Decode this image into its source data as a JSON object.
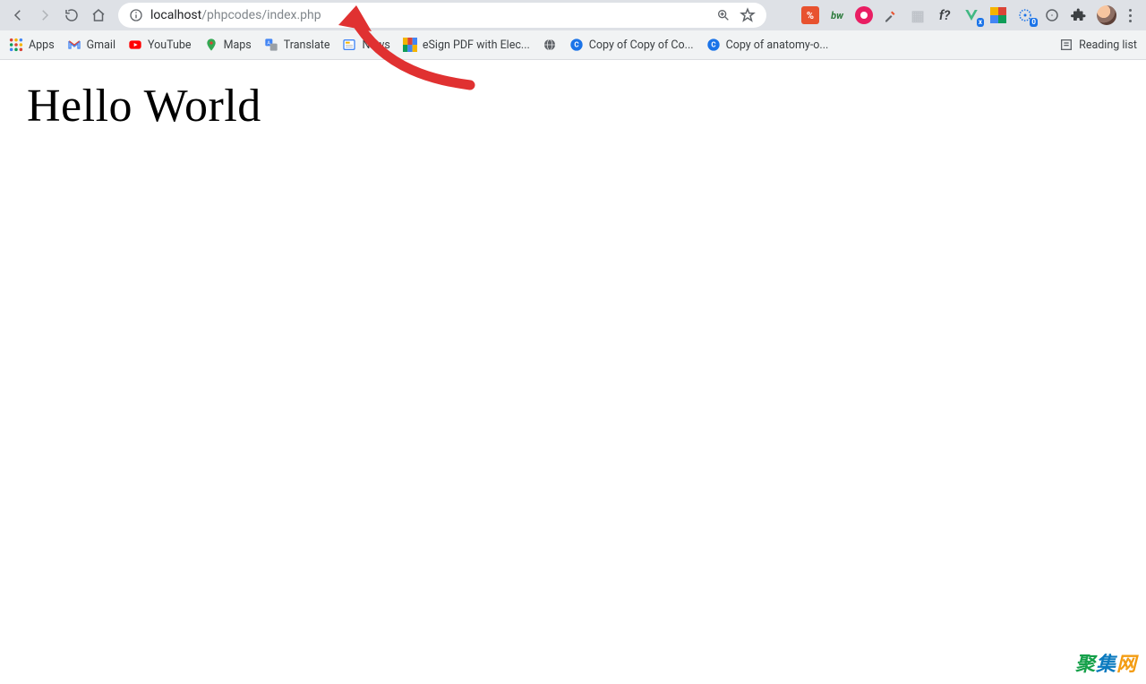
{
  "url": {
    "host": "localhost",
    "path": "/phpcodes/index.php"
  },
  "bookmarks": [
    {
      "label": "Apps",
      "icon": "apps"
    },
    {
      "label": "Gmail",
      "icon": "gmail"
    },
    {
      "label": "YouTube",
      "icon": "youtube"
    },
    {
      "label": "Maps",
      "icon": "maps"
    },
    {
      "label": "Translate",
      "icon": "translate"
    },
    {
      "label": "News",
      "icon": "news"
    },
    {
      "label": "eSign PDF with Elec...",
      "icon": "esign"
    },
    {
      "label": "",
      "icon": "globe"
    },
    {
      "label": "Copy of Copy of Co...",
      "icon": "coda"
    },
    {
      "label": "Copy of anatomy-o...",
      "icon": "coda"
    }
  ],
  "reading_list_label": "Reading list",
  "extensions": [
    {
      "name": "zoho",
      "bg": "#e8522f",
      "txt": "%"
    },
    {
      "name": "buildwith",
      "bg": "transparent",
      "txt": "bw",
      "fg": "#2b7a3b"
    },
    {
      "name": "record",
      "bg": "#e91e63",
      "txt": "◉"
    },
    {
      "name": "eyedropper",
      "bg": "transparent",
      "txt": "",
      "svg": "eyedrop"
    },
    {
      "name": "grid",
      "bg": "#cfd2d6",
      "txt": "▦",
      "fg": "#9aa0a6"
    },
    {
      "name": "whatfont",
      "bg": "transparent",
      "txt": "f?",
      "fg": "#3c4043",
      "italic": true
    },
    {
      "name": "vue",
      "bg": "transparent",
      "txt": "",
      "svg": "vue"
    },
    {
      "name": "pixel",
      "bg": "transparent",
      "txt": "",
      "svg": "pixel"
    },
    {
      "name": "react",
      "bg": "transparent",
      "txt": "",
      "svg": "gear",
      "badge": "0"
    },
    {
      "name": "adblock",
      "bg": "transparent",
      "txt": "",
      "svg": "circle"
    },
    {
      "name": "ext-puzzle",
      "bg": "transparent",
      "txt": "",
      "svg": "puzzle"
    }
  ],
  "page": {
    "heading": "Hello World"
  },
  "watermark": [
    "聚",
    "集",
    "网"
  ]
}
